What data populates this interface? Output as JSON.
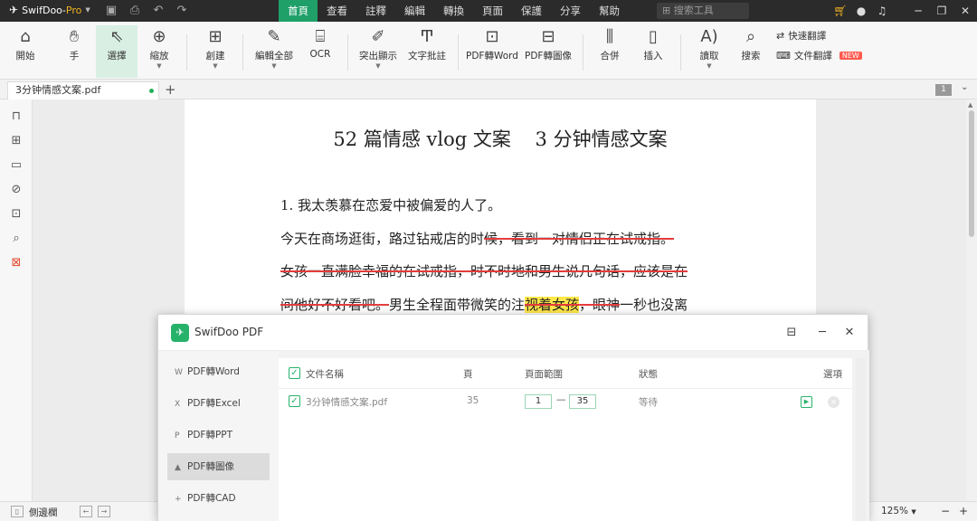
{
  "titlebar": {
    "app_name": "SwifDoo",
    "app_edition": "Pro",
    "menus": [
      "首頁",
      "查看",
      "註釋",
      "編輯",
      "轉換",
      "頁面",
      "保護",
      "分享",
      "幫助"
    ],
    "active_menu": "首頁",
    "search_placeholder": "搜索工具"
  },
  "ribbon": {
    "tools": [
      {
        "label": "開始",
        "icon": "home-icon"
      },
      {
        "label": "手",
        "icon": "hand-icon"
      },
      {
        "label": "選擇",
        "icon": "cursor-icon"
      },
      {
        "label": "縮放",
        "icon": "zoom-icon"
      },
      {
        "label": "創建",
        "icon": "create-icon"
      },
      {
        "label": "編輯全部",
        "icon": "edit-icon"
      },
      {
        "label": "OCR",
        "icon": "ocr-icon"
      },
      {
        "label": "突出顯示",
        "icon": "highlight-icon"
      },
      {
        "label": "文字批註",
        "icon": "text-note-icon"
      },
      {
        "label": "PDF轉Word",
        "icon": "pdf-to-word-icon"
      },
      {
        "label": "PDF轉圖像",
        "icon": "pdf-to-image-icon"
      },
      {
        "label": "合併",
        "icon": "merge-icon"
      },
      {
        "label": "插入",
        "icon": "insert-icon"
      },
      {
        "label": "讀取",
        "icon": "read-aloud-icon"
      },
      {
        "label": "搜索",
        "icon": "search-doc-icon"
      }
    ],
    "quick_translate": "快速翻譯",
    "doc_translate": "文件翻譯",
    "new_badge": "NEW"
  },
  "tabs": {
    "file_name": "3分钟情感文案.pdf",
    "page_count_badge": "1"
  },
  "document": {
    "title": "52 篇情感 vlog 文案    3 分钟情感文案",
    "line1": "1. 我太羡慕在恋爱中被偏爱的人了。",
    "line2_plain": "今天在商场逛街，路过钻戒店的时",
    "line2_struck": "候，看到一对情侣正在试戒指。",
    "line3_struck": "女孩一直满脸幸福的在试戒指，时不时地和男生说几句话，应该是在",
    "line4_part1": "问他好不好看吧。",
    "line4_part2": "男生全程面带微笑的注",
    "line4_highlight": "视着女孩",
    "line4_part3": "，眼神",
    "line4_part4": "一秒也没离"
  },
  "statusbar": {
    "sidebar_label": "側邊欄",
    "zoom": "125%"
  },
  "dialog": {
    "title": "SwifDoo PDF",
    "nav": [
      {
        "label": "PDF轉Word",
        "glyph": "W"
      },
      {
        "label": "PDF轉Excel",
        "glyph": "X"
      },
      {
        "label": "PDF轉PPT",
        "glyph": "P"
      },
      {
        "label": "PDF轉圖像",
        "glyph": "▲"
      },
      {
        "label": "PDF轉CAD",
        "glyph": "+"
      }
    ],
    "active_nav": "PDF轉圖像",
    "columns": {
      "name": "文件名稱",
      "pages": "頁",
      "range": "頁面範圍",
      "status": "狀態",
      "options": "選項"
    },
    "file": {
      "name": "3分钟情感文案.pdf",
      "pages": "35",
      "range_from": "1",
      "range_sep": "—",
      "range_to": "35",
      "status": "等待"
    }
  }
}
